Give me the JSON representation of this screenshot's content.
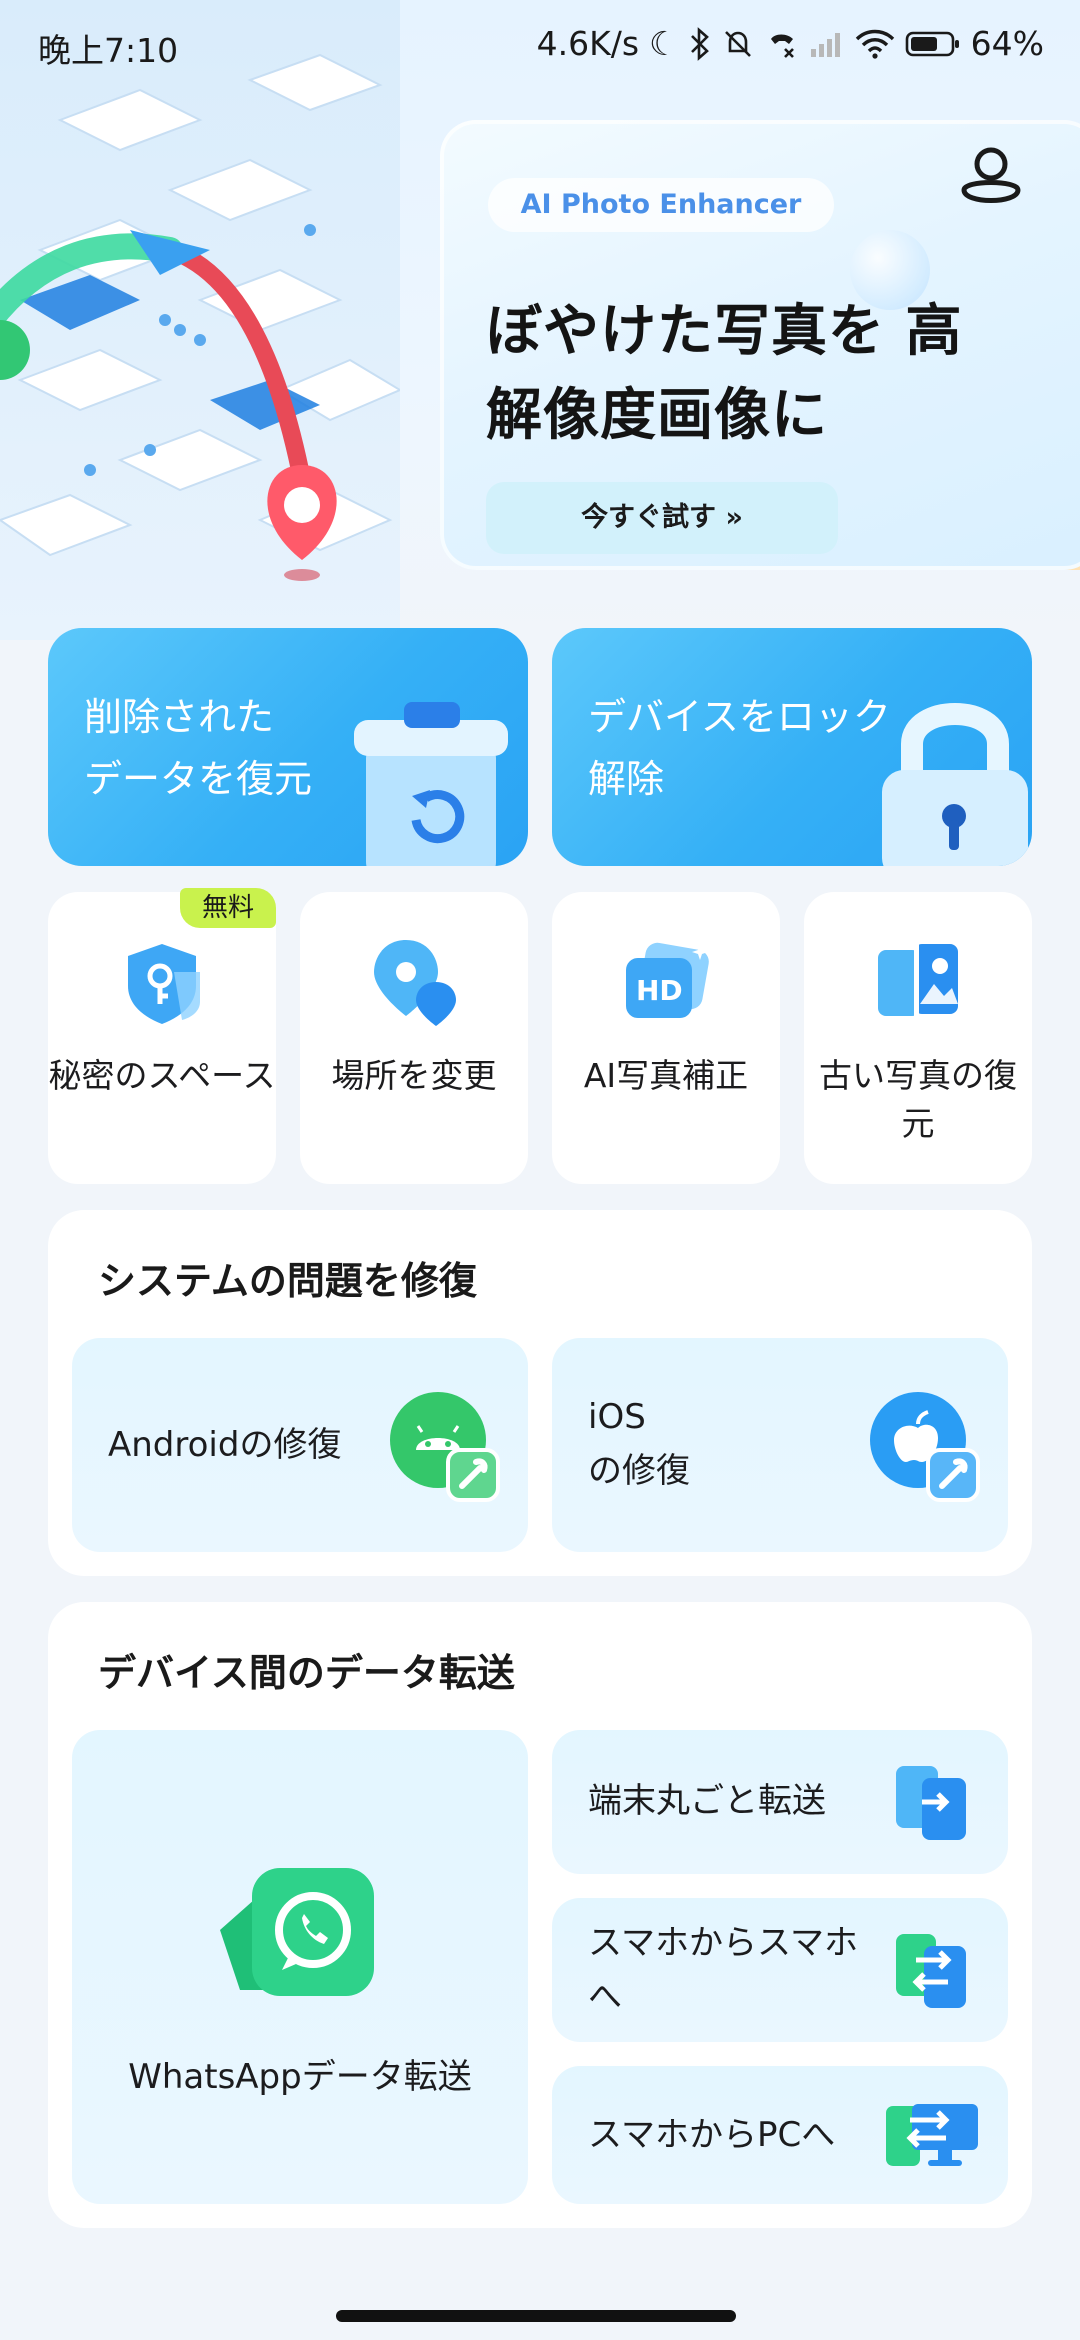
{
  "status_bar": {
    "time": "晚上7:10",
    "net_speed": "4.6K/s",
    "battery": "64%"
  },
  "banner": {
    "tag": "AI Photo Enhancer",
    "headline_line1": "ぼやけた写真を 高",
    "headline_line2": "解像度画像に",
    "cta": "今すぐ試す"
  },
  "feature_cards": [
    {
      "line1": "削除された",
      "line2": "データを復元"
    },
    {
      "line1": "デバイスをロック",
      "line2": "解除"
    }
  ],
  "tools": [
    {
      "label": "秘密のスペース",
      "badge": "無料",
      "icon": "shield-key-icon"
    },
    {
      "label": "場所を変更",
      "icon": "location-pin-icon"
    },
    {
      "label": "AI写真補正",
      "icon": "hd-photo-icon"
    },
    {
      "label": "古い写真の復元",
      "icon": "photo-restore-icon"
    }
  ],
  "system_repair": {
    "title": "システムの問題を修復",
    "android": "Androidの修復",
    "ios_line1": "iOS",
    "ios_line2": "の修復"
  },
  "data_transfer": {
    "title": "デバイス間のデータ転送",
    "whatsapp": "WhatsAppデータ転送",
    "whole_device": "端末丸ごと転送",
    "phone_to_phone": "スマホからスマホへ",
    "phone_to_pc": "スマホからPCへ"
  },
  "colors": {
    "accent_blue": "#35b0f6",
    "free_badge": "#c9f24d",
    "android_green": "#34c76a",
    "ios_blue": "#2a9df4",
    "whatsapp_green": "#2ed28a"
  }
}
